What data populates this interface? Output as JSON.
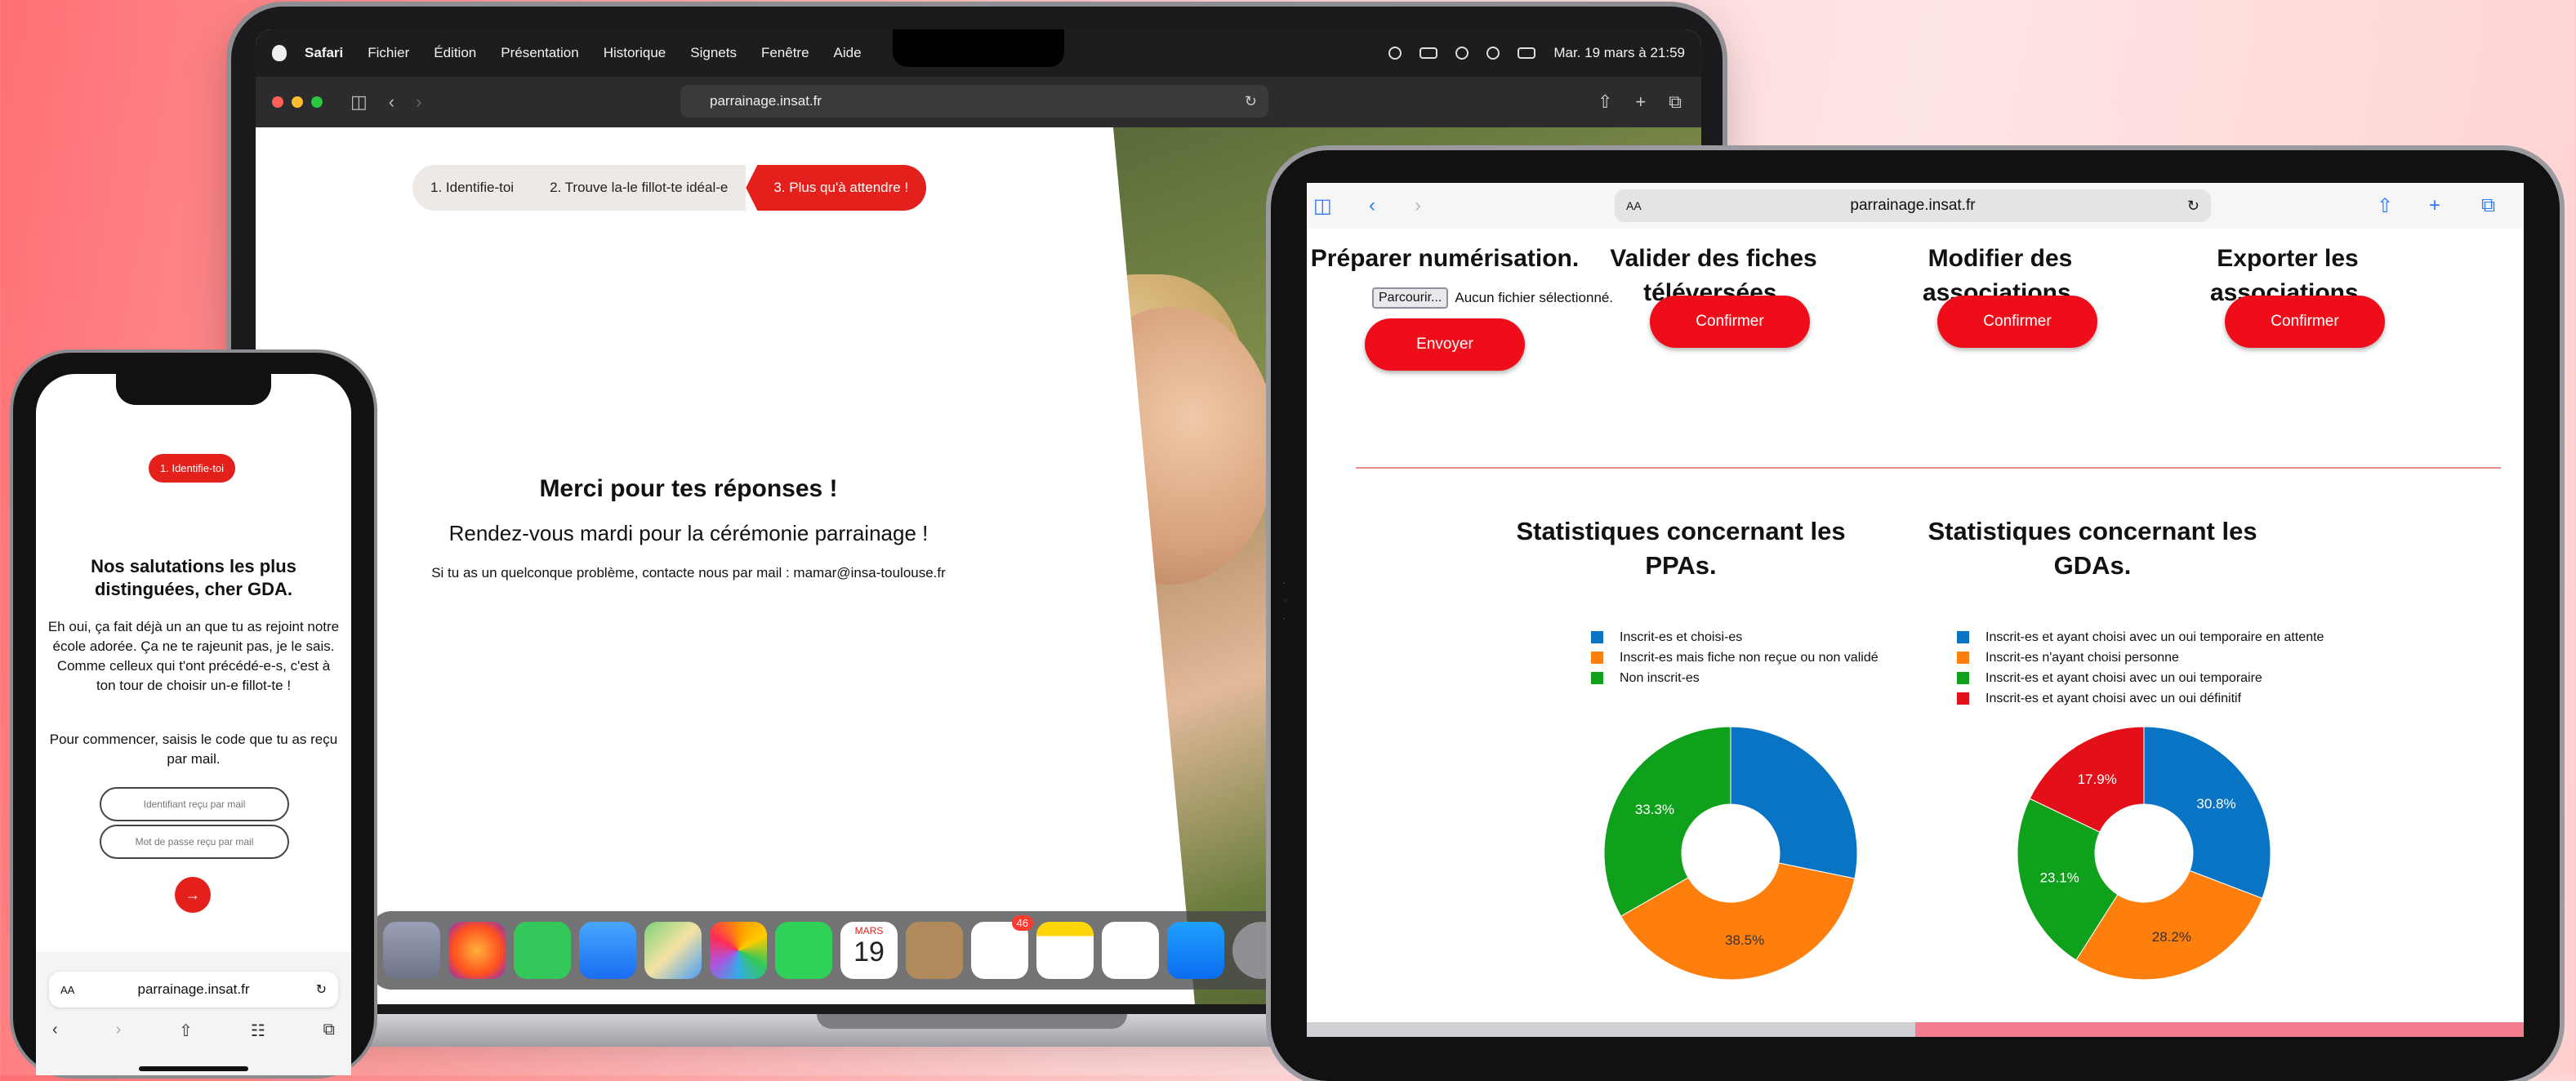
{
  "laptop": {
    "menubar": {
      "app": "Safari",
      "menus": [
        "Fichier",
        "Édition",
        "Présentation",
        "Historique",
        "Signets",
        "Fenêtre",
        "Aide"
      ],
      "clock": "Mar. 19 mars à 21:59"
    },
    "url": "parrainage.insat.fr",
    "steps": [
      "1. Identifie-toi",
      "2. Trouve la-le fillot-te idéal-e",
      "3. Plus qu'à attendre !"
    ],
    "thanks_title": "Merci pour tes réponses !",
    "thanks_sub": "Rendez-vous mardi pour la cérémonie parrainage !",
    "thanks_contact": "Si tu as un quelconque problème, contacte nous par mail : mamar@insa-toulouse.fr",
    "dock": {
      "calendar_month": "MARS",
      "calendar_day": "19",
      "reminders_badge": "46",
      "icons": [
        "launchpad-icon",
        "firefox-icon",
        "messages-icon",
        "mail-icon",
        "maps-icon",
        "photos-icon",
        "facetime-icon",
        "calendar-icon",
        "contacts-icon",
        "reminders-icon",
        "notes-icon",
        "freeform-icon",
        "app-store-icon",
        "settings-icon"
      ]
    }
  },
  "phone": {
    "step": "1. Identifie-toi",
    "title": "Nos salutations les plus distinguées, cher GDA.",
    "body": "Eh oui, ça fait déjà un an que tu as rejoint notre école adorée. Ça ne te rajeunit pas, je le sais. Comme celleux qui t'ont précédé-e-s, c'est à ton tour de choisir un-e fillot-te !",
    "body2": "Pour commencer, saisis le code que tu as reçu par mail.",
    "id_placeholder": "Identifiant reçu par mail",
    "pw_placeholder": "Mot de passe reçu par mail",
    "go": "→",
    "url": "parrainage.insat.fr",
    "aa": "AA"
  },
  "tablet": {
    "url": "parrainage.insat.fr",
    "aa": "AA",
    "actions": [
      {
        "title": "Préparer numérisation.",
        "button": "Envoyer"
      },
      {
        "title": "Valider des fiches téléversées.",
        "button": "Confirmer"
      },
      {
        "title": "Modifier des associations.",
        "button": "Confirmer"
      },
      {
        "title": "Exporter les associations.",
        "button": "Confirmer"
      }
    ],
    "file_button": "Parcourir...",
    "file_status": "Aucun fichier sélectionné.",
    "stats_ppa_title": "Statistiques concernant les PPAs.",
    "stats_gda_title": "Statistiques concernant les GDAs."
  },
  "chart_data": [
    {
      "type": "pie",
      "title": "Statistiques concernant les PPAs.",
      "donut": true,
      "legend_position": "top",
      "labels": [
        "Inscrit-es et choisi-es",
        "Inscrit-es mais fiche non reçue ou non validé",
        "Non inscrit-es"
      ],
      "values": [
        28.2,
        38.5,
        33.3
      ],
      "value_labels": [
        "",
        "38.5%",
        "33.3%"
      ],
      "colors": [
        "#0a74c4",
        "#ff7f0e",
        "#0fa11b"
      ]
    },
    {
      "type": "pie",
      "title": "Statistiques concernant les GDAs.",
      "donut": true,
      "legend_position": "top",
      "labels": [
        "Inscrit-es et ayant choisi avec un oui temporaire en attente",
        "Inscrit-es n'ayant choisi personne",
        "Inscrit-es et ayant choisi avec un oui temporaire",
        "Inscrit-es et ayant choisi avec un oui définitif"
      ],
      "values": [
        30.8,
        28.2,
        23.1,
        17.9
      ],
      "value_labels": [
        "30.8%",
        "28.2%",
        "23.1%",
        "17.9%"
      ],
      "colors": [
        "#0a74c4",
        "#ff7f0e",
        "#0fa11b",
        "#e3101a"
      ]
    }
  ]
}
